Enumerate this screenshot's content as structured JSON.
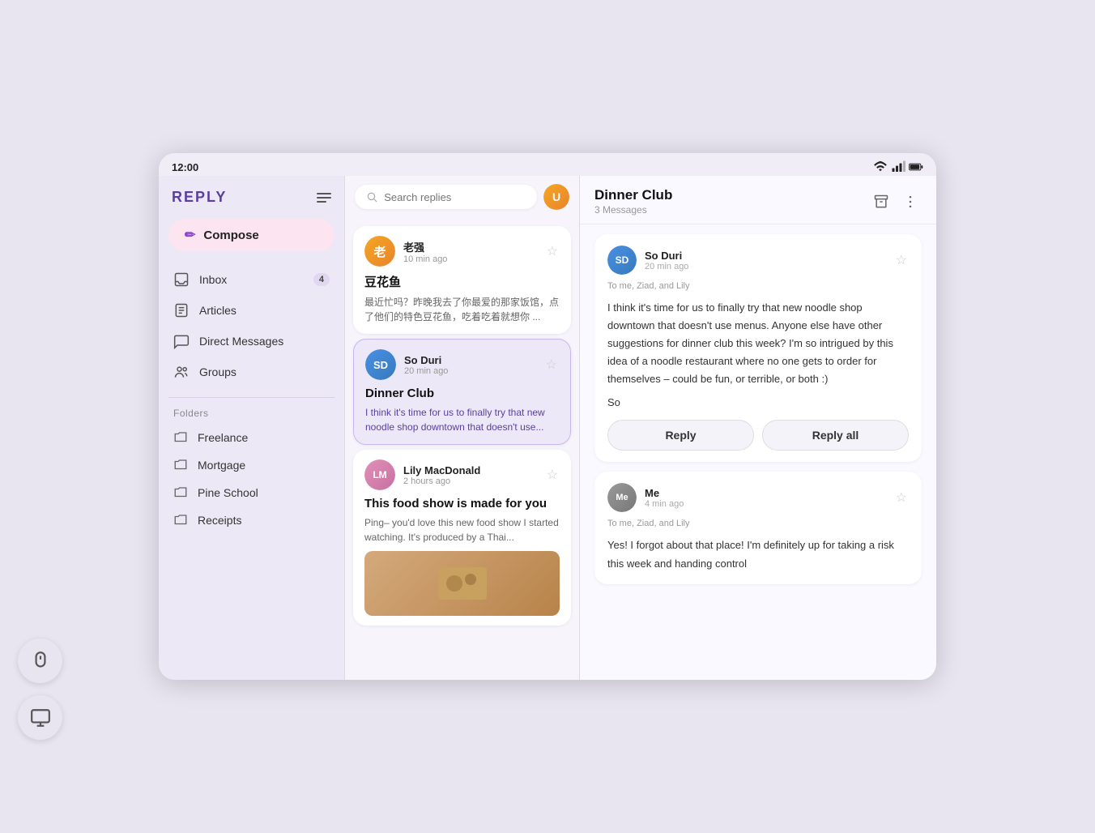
{
  "status_bar": {
    "time": "12:00"
  },
  "sidebar": {
    "logo": "REPLY",
    "compose_label": "Compose",
    "menu_icon": "menu-icon",
    "nav_items": [
      {
        "id": "inbox",
        "label": "Inbox",
        "badge": "4",
        "icon": "inbox-icon"
      },
      {
        "id": "articles",
        "label": "Articles",
        "badge": null,
        "icon": "articles-icon"
      },
      {
        "id": "direct-messages",
        "label": "Direct Messages",
        "badge": null,
        "icon": "direct-messages-icon"
      },
      {
        "id": "groups",
        "label": "Groups",
        "badge": null,
        "icon": "groups-icon"
      }
    ],
    "folders_label": "Folders",
    "folder_items": [
      {
        "id": "freelance",
        "label": "Freelance"
      },
      {
        "id": "mortgage",
        "label": "Mortgage"
      },
      {
        "id": "pine-school",
        "label": "Pine School"
      },
      {
        "id": "receipts",
        "label": "Receipts"
      }
    ]
  },
  "search": {
    "placeholder": "Search replies"
  },
  "message_list": {
    "messages": [
      {
        "id": "msg1",
        "sender": "老强",
        "time_ago": "10 min ago",
        "subject": "豆花鱼",
        "preview": "最近忙吗？昨晚我去了你最爱的那家饭馆，点了他们的特色豆花鱼，吃着吃着就想你 ...",
        "avatar_initials": "老",
        "avatar_color": "orange",
        "selected": false,
        "has_image": false
      },
      {
        "id": "msg2",
        "sender": "So Duri",
        "time_ago": "20 min ago",
        "subject": "Dinner Club",
        "preview": "I think it's time for us to finally try that new noodle shop downtown that doesn't use...",
        "avatar_initials": "SD",
        "avatar_color": "blue",
        "selected": true,
        "has_image": false
      },
      {
        "id": "msg3",
        "sender": "Lily MacDonald",
        "time_ago": "2 hours ago",
        "subject": "This food show is made for you",
        "preview": "Ping– you'd love this new food show I started watching. It's produced by a Thai...",
        "avatar_initials": "LM",
        "avatar_color": "pink",
        "selected": false,
        "has_image": true
      }
    ]
  },
  "detail": {
    "thread_title": "Dinner Club",
    "message_count": "3 Messages",
    "messages": [
      {
        "id": "dm1",
        "sender": "So Duri",
        "time_ago": "20 min ago",
        "to": "To me, Ziad, and Lily",
        "avatar_initials": "SD",
        "avatar_color": "blue",
        "body": "I think it's time for us to finally try that new noodle shop downtown that doesn't use menus. Anyone else have other suggestions for dinner club this week? I'm so intrigued by this idea of a noodle restaurant where no one gets to order for themselves – could be fun, or terrible, or both :)",
        "signature": "So"
      },
      {
        "id": "dm2",
        "sender": "Me",
        "time_ago": "4 min ago",
        "to": "To me, Ziad, and Lily",
        "avatar_initials": "Me",
        "avatar_color": "gray",
        "body": "Yes! I forgot about that place! I'm definitely up for taking a risk this week and handing control",
        "signature": ""
      }
    ],
    "reply_button": "Reply",
    "reply_all_button": "Reply all"
  },
  "floating_icons": {
    "mouse_icon": "mouse-icon",
    "screen_icon": "monitor-icon"
  }
}
